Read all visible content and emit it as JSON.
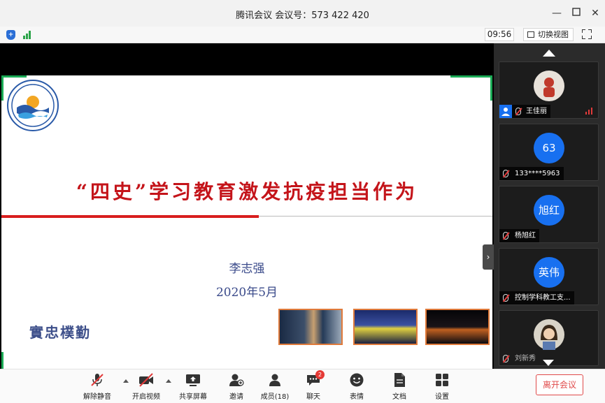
{
  "window": {
    "title": "腾讯会议 会议号：573 422 420"
  },
  "status": {
    "time": "09:56",
    "switch_view_label": "切换视图"
  },
  "slide": {
    "title": "“四史”学习教育激发抗疫担当作为",
    "author": "李志强",
    "date": "2020年5月",
    "motto": "實忠樸勤",
    "logo_label": "SHANGHAI OCEAN UNIVERSITY",
    "logo_year": "1912"
  },
  "participants": [
    {
      "name": "王佳丽",
      "avatar_text": "",
      "type": "photo"
    },
    {
      "name": "133****5963",
      "avatar_text": "63",
      "type": "initials"
    },
    {
      "name": "杨旭红",
      "avatar_text": "旭红",
      "type": "initials"
    },
    {
      "name": "控制学科教工支...",
      "avatar_text": "英伟",
      "type": "initials"
    },
    {
      "name": "刘新秀",
      "avatar_text": "",
      "type": "photo"
    }
  ],
  "toolbar": {
    "unmute": "解除静音",
    "start_video": "开启视频",
    "share_screen": "共享屏幕",
    "invite": "邀请",
    "members": "成员(18)",
    "chat": "聊天",
    "chat_badge": "2",
    "reactions": "表情",
    "docs": "文档",
    "settings": "设置",
    "leave": "离开会议"
  },
  "colors": {
    "accent_blue": "#1870f0",
    "slide_title_red": "#c4141a",
    "leave_red": "#e04a4a",
    "panel_dark": "#2b2b2b"
  }
}
